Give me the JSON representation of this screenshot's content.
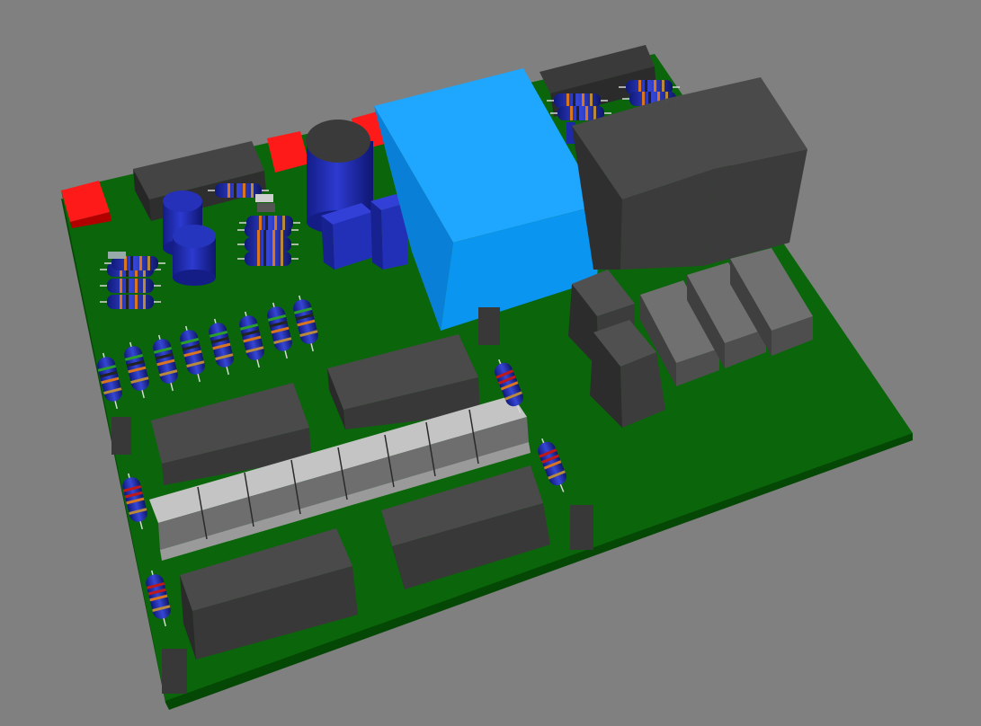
{
  "scene": {
    "subject": "pcb-3d-render",
    "colors": {
      "background": "#808080",
      "board_top": "#0b650b",
      "board_edge": "#054805",
      "transformer": "#0a95f0",
      "red_block": "#ff0000",
      "dark_component": "#3c3c3c",
      "capacitor_blue": "#1c2aa8",
      "relay_grey": "#6e6e6e",
      "connector_light": "#c4c4c4"
    }
  }
}
